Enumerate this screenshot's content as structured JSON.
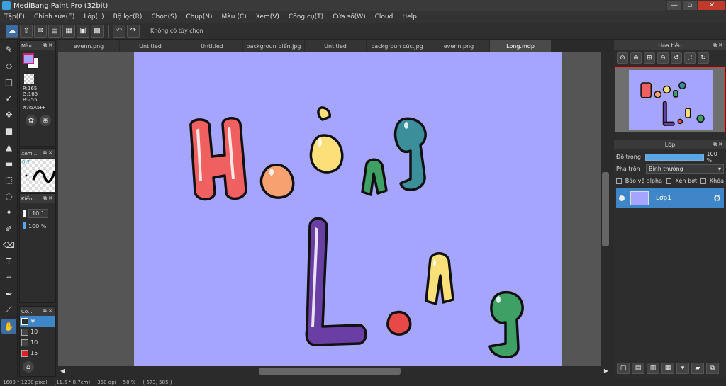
{
  "window": {
    "title": "MediBang Paint Pro (32bit)",
    "minimize": "—",
    "maximize": "▫",
    "close": "✕"
  },
  "menu": [
    "Tệp(F)",
    "Chỉnh sửa(E)",
    "Lớp(L)",
    "Bộ lọc(R)",
    "Chọn(S)",
    "Chụp(N)",
    "Màu (C)",
    "Xem(V)",
    "Công cụ(T)",
    "Cửa sổ(W)",
    "Cloud",
    "Help"
  ],
  "toolbar": {
    "hint": "Không có tùy chọn"
  },
  "color_panel": {
    "title": "Màu",
    "r": "R:165",
    "g": "G:165",
    "b": "B:255",
    "hex": "#A5A5FF",
    "fg": "#a5a5ff",
    "bg": "#ffffff"
  },
  "brush_panel": {
    "title": "Xem ...",
    "size": "0.7"
  },
  "size_panel": {
    "title": "Kiểm...",
    "size": "10.1",
    "opacity": "100 %"
  },
  "brushsize_panel": {
    "title": "Co...",
    "items": [
      "10",
      "10",
      "15"
    ]
  },
  "tabs": [
    "evenn.png",
    "Untitled",
    "Untitled",
    "backgroun biển.jpg",
    "Untitled",
    "backgroun cúc.jpg",
    "evenn.png",
    "Long.mdp"
  ],
  "active_tab": 7,
  "navigator": {
    "title": "Hoa tiêu"
  },
  "layers": {
    "title": "Lớp",
    "opacity_label": "Độ trong",
    "opacity_value": "100 %",
    "blend_label": "Pha trộn",
    "blend_value": "Bình thường",
    "protect_alpha": "Bảo vệ alpha",
    "clipping": "Xén bớt",
    "lock": "Khóa",
    "layer_name": "Lớp1"
  },
  "canvas": {
    "background": "#a5a5ff",
    "line1": "Hoàng",
    "line2": "Long",
    "colors": {
      "red": "#f06060",
      "orange": "#f7a070",
      "yellow": "#fbe07a",
      "green": "#3fa066",
      "teal": "#3a8f9a",
      "purple": "#6a3fa5",
      "red2": "#e84848"
    }
  },
  "status": {
    "size": "1600 * 1200 pixel",
    "cm": "(11.6 * 8.7cm)",
    "dpi": "350 dpi",
    "zoom": "50 %",
    "coords": "( 673, 585 )"
  }
}
